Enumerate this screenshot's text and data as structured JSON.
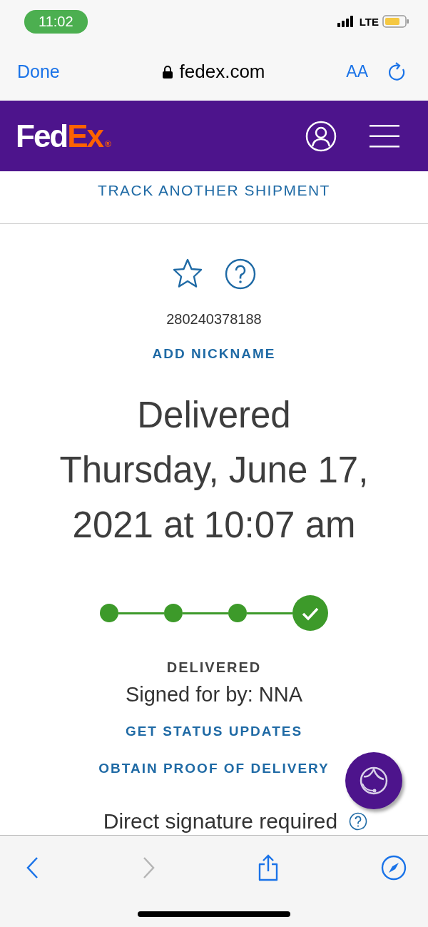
{
  "status_bar": {
    "time": "11:02",
    "network": "LTE"
  },
  "browser": {
    "done": "Done",
    "domain": "fedex.com",
    "text_size": "AA"
  },
  "header": {
    "logo_left": "Fed",
    "logo_right": "Ex",
    "logo_mark": "®"
  },
  "track_another": "TRACK ANOTHER SHIPMENT",
  "shipment": {
    "favorite": false,
    "tracking_number": "280240378188",
    "add_nickname": "ADD NICKNAME",
    "status_heading": "Delivered",
    "date_lines": [
      "Thursday, June 17,",
      "2021 at 10:07 am"
    ],
    "steps": [
      {
        "done": true,
        "current": false
      },
      {
        "done": true,
        "current": false
      },
      {
        "done": true,
        "current": false
      },
      {
        "done": true,
        "current": true
      }
    ],
    "status_label": "DELIVERED",
    "signed_for": "Signed for by: NNA",
    "links": [
      "GET STATUS UPDATES",
      "OBTAIN PROOF OF DELIVERY"
    ],
    "signature_note": "Direct signature required"
  },
  "toolbar": {
    "back_disabled": false,
    "forward_disabled": true
  }
}
